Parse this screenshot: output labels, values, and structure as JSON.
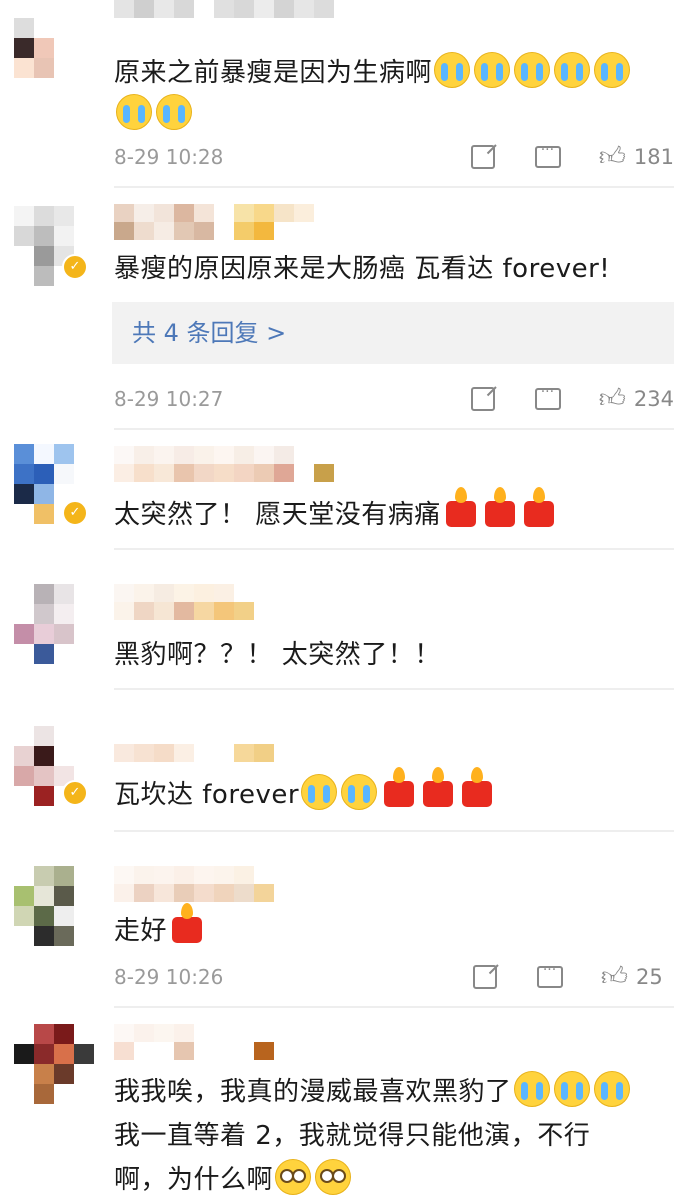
{
  "comments": [
    {
      "text_parts": [
        "原来之前暴瘦是因为生病啊"
      ],
      "emojis": [
        "cry",
        "cry",
        "cry",
        "cry",
        "cry",
        "cry",
        "cry"
      ],
      "time": "8-29 10:28",
      "likes": "181"
    },
    {
      "text": "暴瘦的原因原来是大肠癌  瓦看达 forever!",
      "replies_label": "共 4 条回复 >",
      "time": "8-29 10:27",
      "likes": "234",
      "verified": true
    },
    {
      "text": "太突然了！ 愿天堂没有病痛",
      "emojis": [
        "candle",
        "candle",
        "candle"
      ],
      "verified": true
    },
    {
      "text": "黑豹啊？？！ 太突然了！！"
    },
    {
      "text": "瓦坎达 forever",
      "emojis": [
        "cry",
        "cry",
        "candle",
        "candle",
        "candle"
      ],
      "verified": true
    },
    {
      "text": "走好",
      "emojis": [
        "candle"
      ],
      "time": "8-29 10:26",
      "likes": "25"
    },
    {
      "line1": "我我唉，我真的漫威最喜欢黑豹了",
      "line2": "我一直等着 2，我就觉得只能他演，不行",
      "line3": "啊，为什么啊",
      "emojis_line1": [
        "cry",
        "cry",
        "cry"
      ],
      "emojis_line3": [
        "roll",
        "roll"
      ]
    }
  ],
  "icons": {
    "share": "share-icon",
    "comment": "comment-icon",
    "like": "thumbs-up-icon",
    "verified": "verified-badge-icon"
  },
  "colors": {
    "reply_link": "#4d78b8",
    "meta_gray": "#9a9a9a",
    "badge": "#f4b51a",
    "candle": "#e82b1f"
  }
}
